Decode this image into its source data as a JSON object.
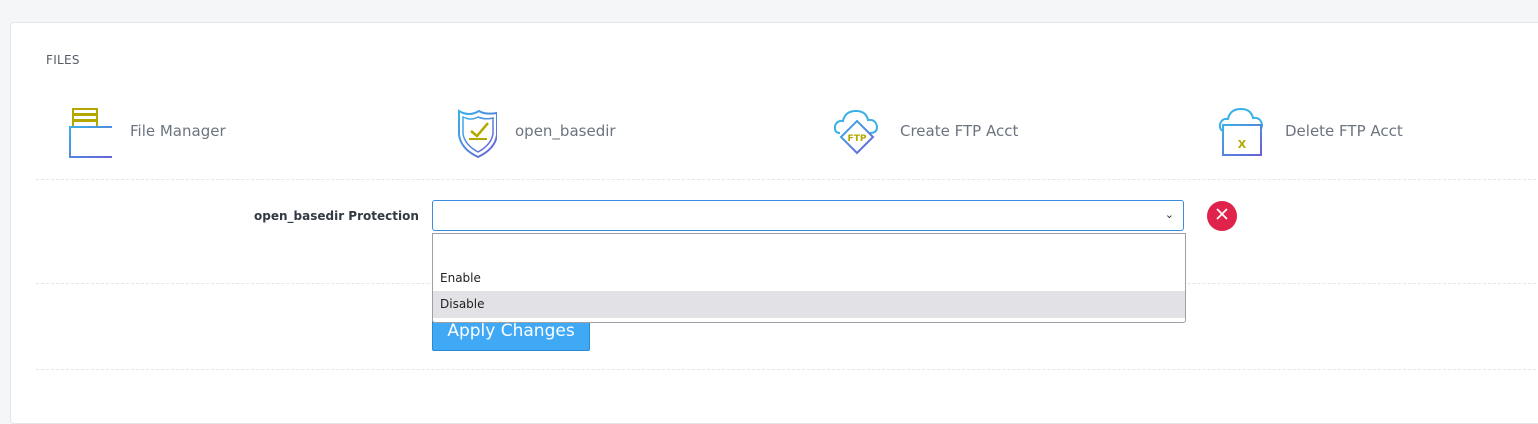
{
  "section": {
    "title": "FILES"
  },
  "tools": [
    {
      "label": "File Manager",
      "icon": "folder-cabinet-icon"
    },
    {
      "label": "open_basedir",
      "icon": "shield-check-icon"
    },
    {
      "label": "Create FTP Acct",
      "icon": "cloud-ftp-icon"
    },
    {
      "label": "Delete FTP Acct",
      "icon": "cloud-folder-delete-icon"
    }
  ],
  "form": {
    "label": "open_basedir Protection",
    "select_value": "",
    "options": [
      "",
      "Enable",
      "Disable"
    ],
    "highlighted_option": "Disable",
    "apply_label": "Apply Changes",
    "close_icon": "close-circle-icon"
  },
  "colors": {
    "accent_blue": "#3fa9f5",
    "danger_red": "#e0234a",
    "icon_olive": "#b3a800",
    "icon_blue": "#3ab0e6",
    "icon_purple": "#6b5fd6"
  }
}
